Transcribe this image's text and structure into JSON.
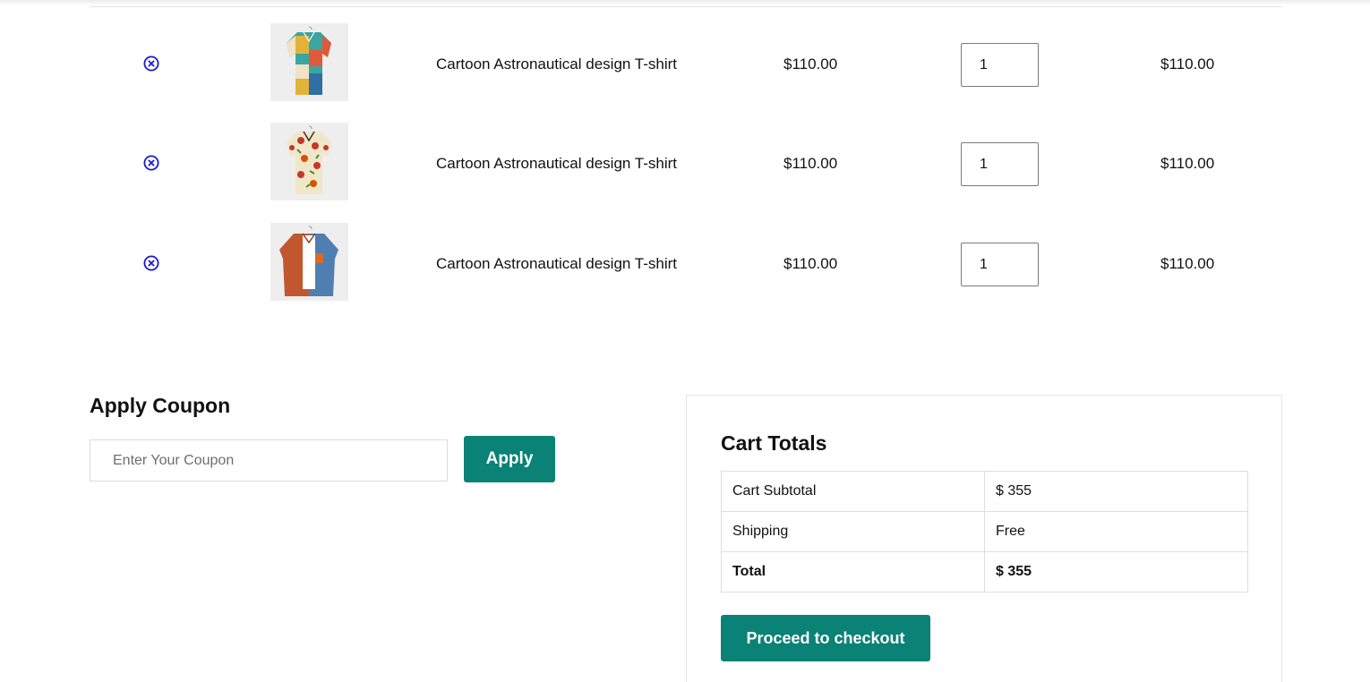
{
  "cart": {
    "items": [
      {
        "name": "Cartoon Astronautical design T-shirt",
        "price": "$110.00",
        "quantity": "1",
        "total": "$110.00",
        "image": "shirt-geometric-patchwork"
      },
      {
        "name": "Cartoon Astronautical design T-shirt",
        "price": "$110.00",
        "quantity": "1",
        "total": "$110.00",
        "image": "shirt-floral-print"
      },
      {
        "name": "Cartoon Astronautical design T-shirt",
        "price": "$110.00",
        "quantity": "1",
        "total": "$110.00",
        "image": "shirt-rust-denim-colorblock"
      }
    ],
    "remove_icon": "close-circle-icon",
    "remove_icon_color": "#1a1acc"
  },
  "coupon": {
    "heading": "Apply Coupon",
    "placeholder": "Enter Your Coupon",
    "value": "",
    "apply_label": "Apply"
  },
  "totals": {
    "heading": "Cart Totals",
    "rows": [
      {
        "label": "Cart Subtotal",
        "value": "$ 355"
      },
      {
        "label": "Shipping",
        "value": "Free"
      },
      {
        "label": "Total",
        "value": "$ 355"
      }
    ],
    "checkout_label": "Proceed to checkout"
  },
  "colors": {
    "accent": "#0b8276",
    "remove_icon": "#1a1acc",
    "border": "#dedede"
  }
}
